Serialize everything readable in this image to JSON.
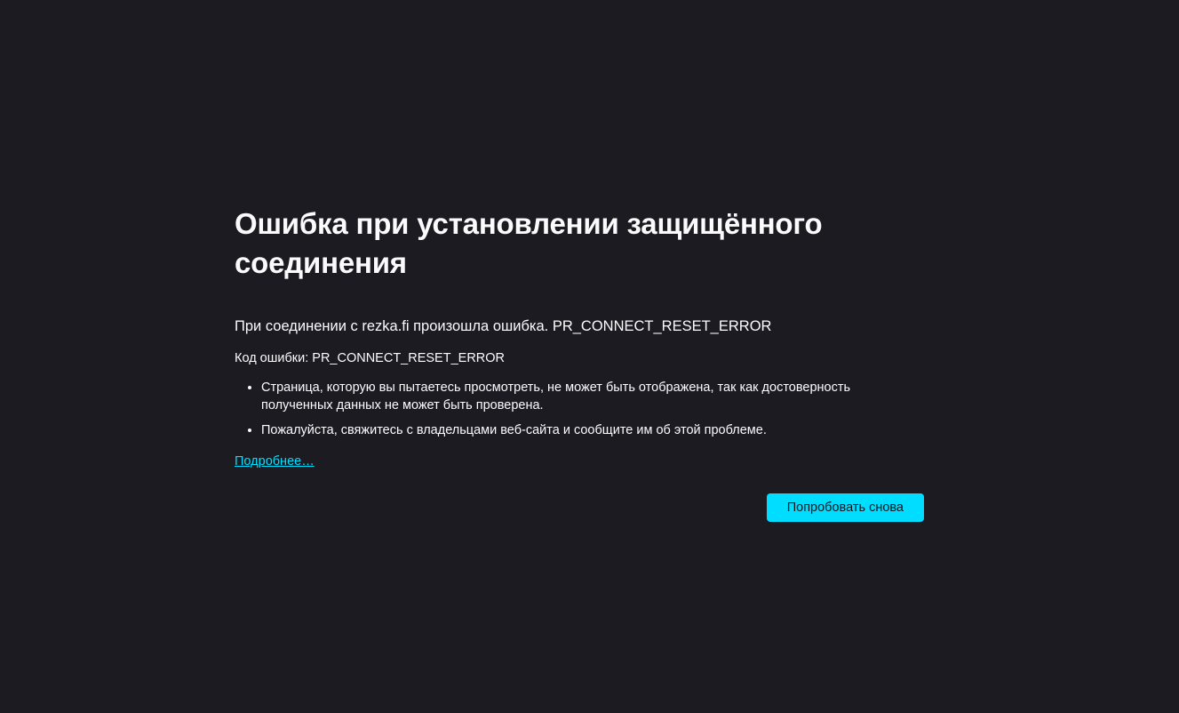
{
  "error_page": {
    "title": "Ошибка при установлении защищённого соединения",
    "short_description": "При соединении с rezka.fi произошла ошибка. PR_CONNECT_RESET_ERROR",
    "error_code": "Код ошибки: PR_CONNECT_RESET_ERROR",
    "details": [
      "Страница, которую вы пытаетесь просмотреть, не может быть отображена, так как достоверность полученных данных не может быть проверена.",
      "Пожалуйста, свяжитесь с владельцами веб-сайта и сообщите им об этой проблеме."
    ],
    "learn_more_label": "Подробнее…",
    "retry_label": "Попробовать снова"
  },
  "colors": {
    "background": "#1c1b22",
    "text": "#fbfbfe",
    "accent": "#00ddff"
  }
}
